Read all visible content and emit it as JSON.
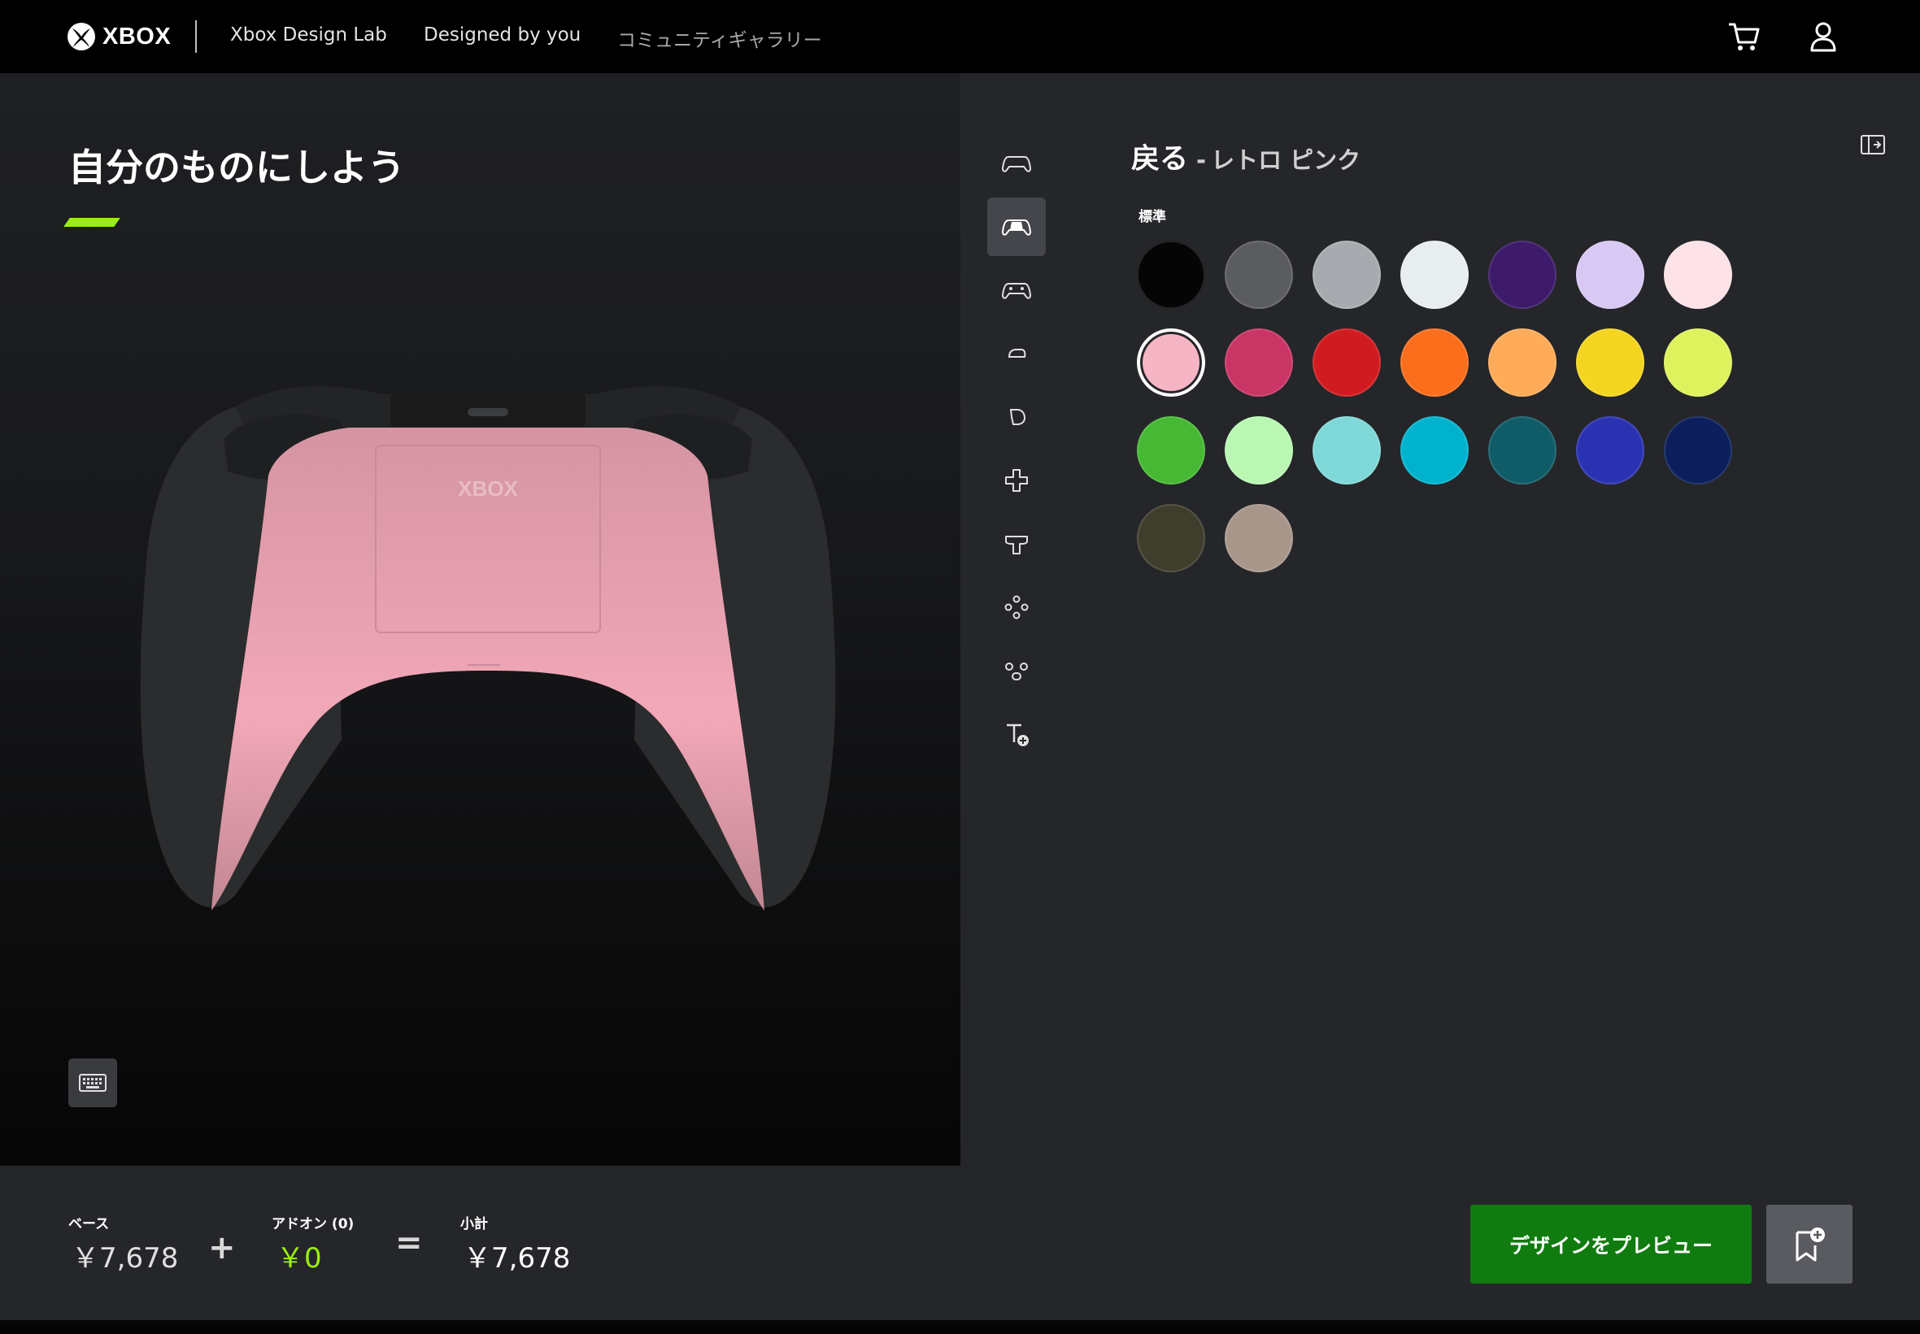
{
  "nav": {
    "brand": "XBOX",
    "links": [
      "Xbox Design Lab",
      "Designed by you",
      "コミュニティギャラリー"
    ],
    "icons": [
      "cart-icon",
      "account-icon"
    ]
  },
  "preview": {
    "title": "自分のものにしよう",
    "accent_color": "#9bf00b",
    "controller_color": "#f2a8b8",
    "keyboard_icon": "keyboard-icon"
  },
  "panel": {
    "back_label": "戻る",
    "separator": "-",
    "selected_name": "レトロ ピンク",
    "group_label": "標準",
    "rail_icons": [
      "controller-front-icon",
      "controller-back-icon",
      "controller-grips-icon",
      "bumpers-icon",
      "triggers-icon",
      "dpad-icon",
      "thumbsticks-icon",
      "abxy-buttons-icon",
      "view-menu-share-icon",
      "engraving-icon"
    ],
    "active_rail_index": 1,
    "swatches": [
      "#050505",
      "#5a5c60",
      "#a7abaf",
      "#e8edef",
      "#3d1a6a",
      "#d7c8f4",
      "#fde2e8",
      "#f6b5c4",
      "#c93565",
      "#d01c20",
      "#fb6e1c",
      "#ffab57",
      "#f4d51f",
      "#ddf25c",
      "#46b834",
      "#b9f7b3",
      "#7fd8d8",
      "#00b2cd",
      "#0f5b68",
      "#2b32b2",
      "#0c1f5c",
      "#3f3d2b",
      "#a8968b"
    ],
    "selected_swatch_index": 7
  },
  "footer": {
    "base_label": "ベース",
    "base_value": "￥7,678",
    "plus": "+",
    "addon_label": "アドオン (0)",
    "addon_value": "￥0",
    "equals": "=",
    "subtotal_label": "小計",
    "subtotal_value": "￥7,678",
    "preview_button_label": "デザインをプレビュー",
    "save_icon": "bookmark-add-icon",
    "primary_color": "#107c10"
  }
}
